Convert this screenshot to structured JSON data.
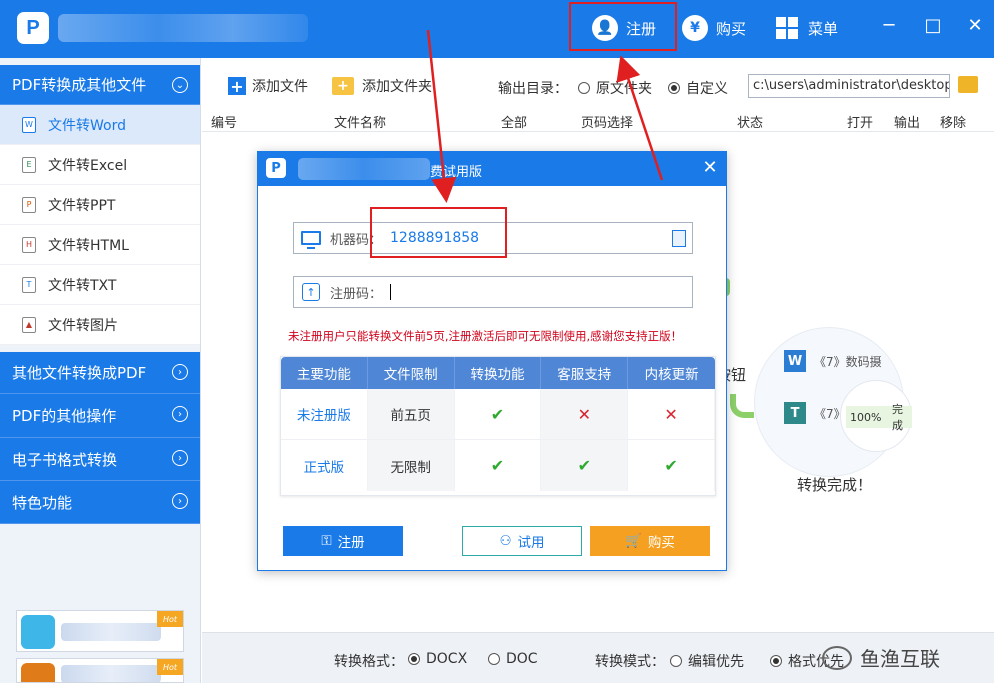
{
  "titlebar": {
    "logo_letter": "P",
    "register_label": "注册",
    "register_icon": "user-plus-icon",
    "buy_label": "购买",
    "buy_icon": "yen-icon",
    "buy_icon_glyph": "¥",
    "menu_label": "菜单",
    "menu_icon": "grid-icon",
    "minimize": "─",
    "maximize": "□",
    "close": "✕"
  },
  "sidebar": {
    "sections": [
      {
        "label": "PDF转换成其他文件",
        "expanded": true
      },
      {
        "label": "其他文件转换成PDF",
        "expanded": false
      },
      {
        "label": "PDF的其他操作",
        "expanded": false
      },
      {
        "label": "电子书格式转换",
        "expanded": false
      },
      {
        "label": "特色功能",
        "expanded": false
      }
    ],
    "items": [
      {
        "label": "文件转Word",
        "icon": "W",
        "active": true
      },
      {
        "label": "文件转Excel",
        "icon": "E"
      },
      {
        "label": "文件转PPT",
        "icon": "P"
      },
      {
        "label": "文件转HTML",
        "icon": "H"
      },
      {
        "label": "文件转TXT",
        "icon": "T"
      },
      {
        "label": "文件转图片",
        "icon": "▲"
      }
    ],
    "expand_glyph": "⌄",
    "collapsed_glyph": "›",
    "hot_badge": "Hot"
  },
  "toolbar": {
    "add_file": "添加文件",
    "add_folder": "添加文件夹",
    "output_dir_label": "输出目录：",
    "option_source": "原文件夹",
    "option_custom": "自定义",
    "selected_option": "自定义",
    "path_value": "c:\\users\\administrator\\desktop\\"
  },
  "table": {
    "headers": [
      "编号",
      "文件名称",
      "全部",
      "页码选择",
      "状态",
      "打开",
      "输出",
      "移除"
    ]
  },
  "illustration": {
    "hint": "按钮",
    "file1": "《7》数码摄",
    "file2": "《7》",
    "progress": "100%",
    "progress_status": "完成",
    "done": "转换完成！"
  },
  "bottom": {
    "format_label": "转换格式：",
    "format_docx": "DOCX",
    "format_doc": "DOC",
    "selected_format": "DOCX",
    "mode_label": "转换模式：",
    "mode_edit": "编辑优先",
    "mode_layout": "格式优先",
    "selected_mode": "格式优先",
    "watermark": "鱼渔互联"
  },
  "dialog": {
    "logo_letter": "P",
    "title_suffix": "费试用版",
    "close": "✕",
    "machine_code_label": "机器码：",
    "machine_code_value": "1288891858",
    "reg_code_label": "注册码：",
    "reg_code_value": "",
    "notice": "未注册用户只能转换文件前5页,注册激活后即可无限制使用,感谢您支持正版！",
    "table_headers": [
      "主要功能",
      "文件限制",
      "转换功能",
      "客服支持",
      "内核更新"
    ],
    "rows": [
      {
        "edition": "未注册版",
        "limit": "前五页",
        "convert": "check",
        "support": "cross",
        "update": "cross"
      },
      {
        "edition": "正式版",
        "limit": "无限制",
        "convert": "check",
        "support": "check",
        "update": "check"
      }
    ],
    "btn_register": "注册",
    "btn_trial": "试用",
    "btn_buy": "购买"
  },
  "colors": {
    "primary": "#1a7ae8",
    "annotation_red": "#e02020",
    "notice_red": "#d0021b",
    "check_green": "#2eaa2e",
    "cross_red": "#d9232d",
    "buy_orange": "#f5a020"
  }
}
